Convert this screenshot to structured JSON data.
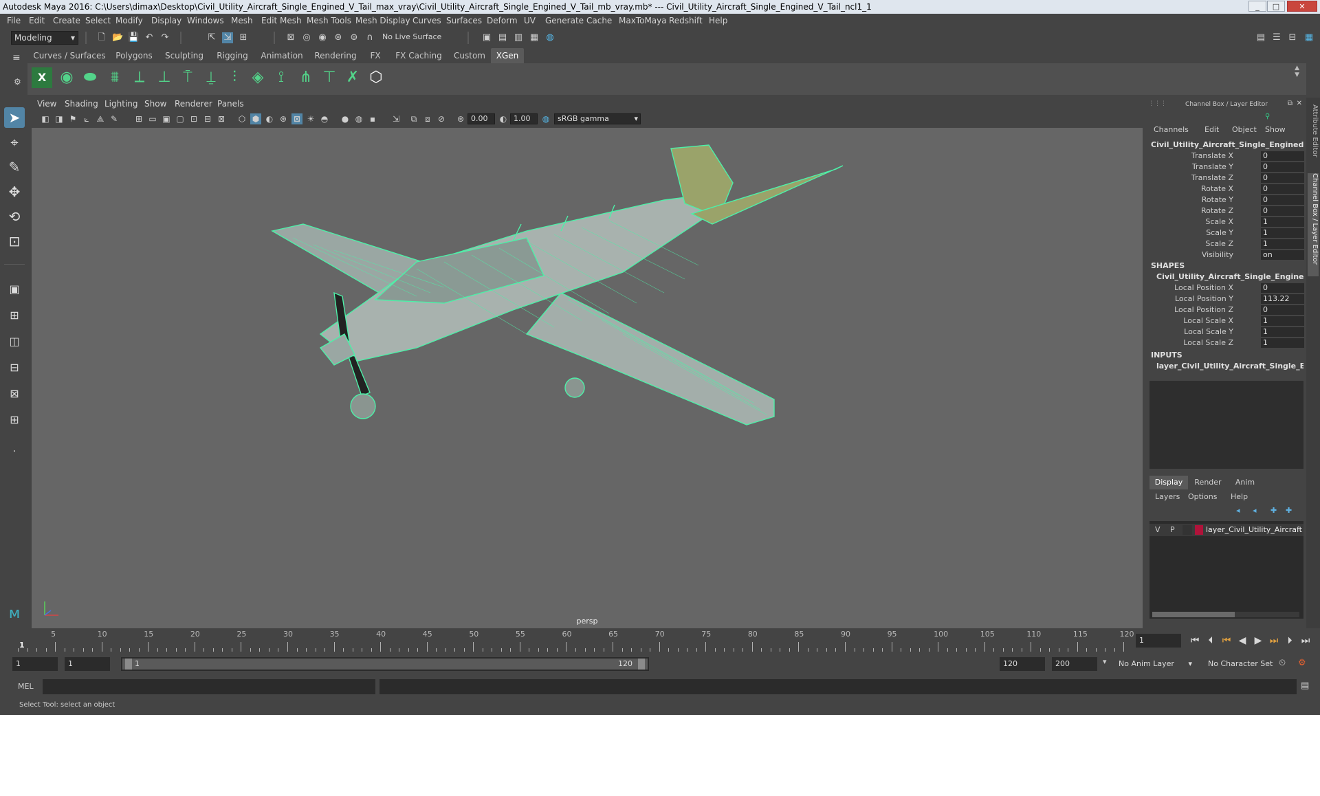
{
  "window": {
    "title": "Autodesk Maya 2016: C:\\Users\\dimax\\Desktop\\Civil_Utility_Aircraft_Single_Engined_V_Tail_max_vray\\Civil_Utility_Aircraft_Single_Engined_V_Tail_mb_vray.mb*   ---   Civil_Utility_Aircraft_Single_Engined_V_Tail_ncl1_1",
    "controls": [
      "_",
      "□",
      "✕"
    ]
  },
  "menubar": [
    "File",
    "Edit",
    "Create",
    "Select",
    "Modify",
    "Display",
    "Windows",
    "Mesh",
    "Edit Mesh",
    "Mesh Tools",
    "Mesh Display",
    "Curves",
    "Surfaces",
    "Deform",
    "UV",
    "Generate",
    "Cache",
    "MaxToMaya",
    "Redshift",
    "Help"
  ],
  "statusline": {
    "mode": "Modeling",
    "live_surface": "No Live Surface"
  },
  "shelf": {
    "tabs": [
      "Curves / Surfaces",
      "Polygons",
      "Sculpting",
      "Rigging",
      "Animation",
      "Rendering",
      "FX",
      "FX Caching",
      "Custom",
      "XGen"
    ],
    "active_tab": "XGen"
  },
  "viewport": {
    "menu": [
      "View",
      "Shading",
      "Lighting",
      "Show",
      "Renderer",
      "Panels"
    ],
    "exposure": "0.00",
    "gamma": "1.00",
    "color_space": "sRGB gamma",
    "camera": "persp"
  },
  "channelbox": {
    "header": "Channel Box / Layer Editor",
    "menu": [
      "Channels",
      "Edit",
      "Object",
      "Show"
    ],
    "object_name": "Civil_Utility_Aircraft_Single_Engined_V_T...",
    "channels": [
      {
        "label": "Translate X",
        "value": "0"
      },
      {
        "label": "Translate Y",
        "value": "0"
      },
      {
        "label": "Translate Z",
        "value": "0"
      },
      {
        "label": "Rotate X",
        "value": "0"
      },
      {
        "label": "Rotate Y",
        "value": "0"
      },
      {
        "label": "Rotate Z",
        "value": "0"
      },
      {
        "label": "Scale X",
        "value": "1"
      },
      {
        "label": "Scale Y",
        "value": "1"
      },
      {
        "label": "Scale Z",
        "value": "1"
      },
      {
        "label": "Visibility",
        "value": "on"
      }
    ],
    "shapes_header": "SHAPES",
    "shape_name": "Civil_Utility_Aircraft_Single_Engined_V...",
    "shape_channels": [
      {
        "label": "Local Position X",
        "value": "0"
      },
      {
        "label": "Local Position Y",
        "value": "113.22"
      },
      {
        "label": "Local Position Z",
        "value": "0"
      },
      {
        "label": "Local Scale X",
        "value": "1"
      },
      {
        "label": "Local Scale Y",
        "value": "1"
      },
      {
        "label": "Local Scale Z",
        "value": "1"
      }
    ],
    "inputs_header": "INPUTS",
    "input_name": "layer_Civil_Utility_Aircraft_Single_Engi..."
  },
  "layer_editor": {
    "tabs": [
      "Display",
      "Render",
      "Anim"
    ],
    "active_tab": "Display",
    "menu": [
      "Layers",
      "Options",
      "Help"
    ],
    "layer": {
      "v": "V",
      "p": "P",
      "name": "layer_Civil_Utility_Aircraft",
      "color": "#b0133a"
    }
  },
  "side_tabs": [
    "Attribute Editor",
    "Channel Box / Layer Editor"
  ],
  "timeline": {
    "ticks": [
      "5",
      "10",
      "15",
      "20",
      "25",
      "30",
      "35",
      "40",
      "45",
      "50",
      "55",
      "60",
      "65",
      "70",
      "75",
      "80",
      "85",
      "90",
      "95",
      "100",
      "105",
      "110",
      "115",
      "120"
    ],
    "current_frame": "1",
    "current_frame_field": "1"
  },
  "range": {
    "start": "1",
    "start_inner": "1",
    "slider_start": "1",
    "slider_end": "120",
    "end_inner": "120",
    "end": "200",
    "anim_layer": "No Anim Layer",
    "character_set": "No Character Set"
  },
  "cmdline": {
    "label": "MEL"
  },
  "helpline": {
    "text": "Select Tool: select an object"
  },
  "colors": {
    "wire": "#4df0a8",
    "accent_blue": "#5285a6",
    "layer_color": "#b0133a"
  }
}
